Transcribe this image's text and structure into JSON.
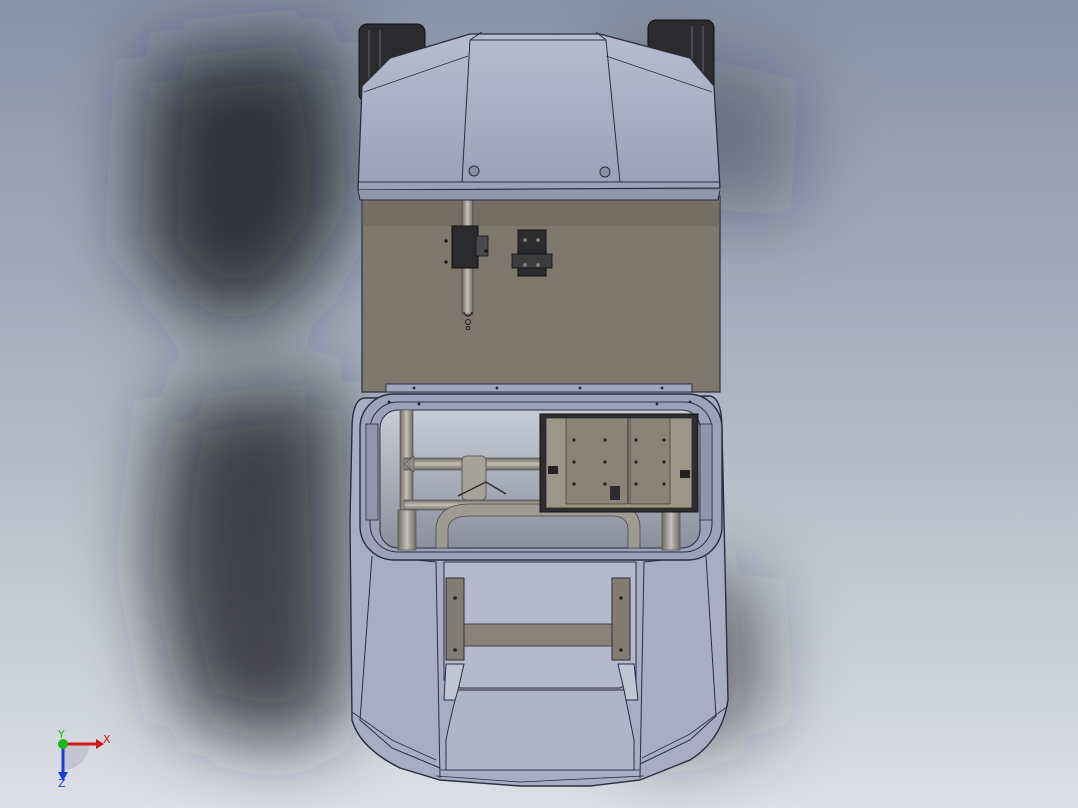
{
  "viewport": {
    "background_top": "#8793a6",
    "background_bottom": "#dcdfe5"
  },
  "model": {
    "body_color": "#a9adc4",
    "edge_color": "#2a2d3f",
    "floor_color": "#7f786d",
    "tube_color": "#8f8c84",
    "tire_color": "#2b2b2e",
    "shadow_color": "#1e2024"
  },
  "triad": {
    "x_label": "X",
    "y_label": "Y",
    "z_label": "Z",
    "x_color": "#d01818",
    "y_color": "#18b818",
    "z_color": "#1a3fd0",
    "icon": "coordinate-triad-icon"
  }
}
